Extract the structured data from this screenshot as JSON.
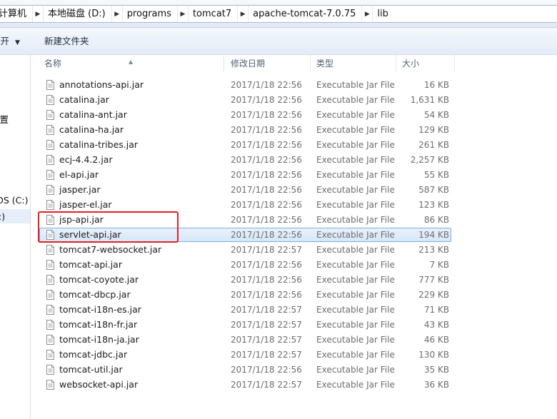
{
  "breadcrumb": {
    "items": [
      "计算机",
      "本地磁盘 (D:)",
      "programs",
      "tomcat7",
      "apache-tomcat-7.0.75",
      "lib"
    ]
  },
  "toolbar": {
    "open_label": "打开",
    "new_folder_label": "新建文件夹"
  },
  "nav": {
    "location_label": "位置",
    "drive_c_label": "OS (C:)",
    "drive_d_label": ":)"
  },
  "columns": {
    "name": "名称",
    "date": "修改日期",
    "type": "类型",
    "size": "大小"
  },
  "files": [
    {
      "name": "annotations-api.jar",
      "date": "2017/1/18 22:56",
      "type": "Executable Jar File",
      "size": "16 KB"
    },
    {
      "name": "catalina.jar",
      "date": "2017/1/18 22:56",
      "type": "Executable Jar File",
      "size": "1,631 KB"
    },
    {
      "name": "catalina-ant.jar",
      "date": "2017/1/18 22:56",
      "type": "Executable Jar File",
      "size": "54 KB"
    },
    {
      "name": "catalina-ha.jar",
      "date": "2017/1/18 22:56",
      "type": "Executable Jar File",
      "size": "129 KB"
    },
    {
      "name": "catalina-tribes.jar",
      "date": "2017/1/18 22:56",
      "type": "Executable Jar File",
      "size": "261 KB"
    },
    {
      "name": "ecj-4.4.2.jar",
      "date": "2017/1/18 22:56",
      "type": "Executable Jar File",
      "size": "2,257 KB"
    },
    {
      "name": "el-api.jar",
      "date": "2017/1/18 22:56",
      "type": "Executable Jar File",
      "size": "55 KB"
    },
    {
      "name": "jasper.jar",
      "date": "2017/1/18 22:56",
      "type": "Executable Jar File",
      "size": "587 KB"
    },
    {
      "name": "jasper-el.jar",
      "date": "2017/1/18 22:56",
      "type": "Executable Jar File",
      "size": "123 KB"
    },
    {
      "name": "jsp-api.jar",
      "date": "2017/1/18 22:56",
      "type": "Executable Jar File",
      "size": "86 KB"
    },
    {
      "name": "servlet-api.jar",
      "date": "2017/1/18 22:56",
      "type": "Executable Jar File",
      "size": "194 KB",
      "selected": true
    },
    {
      "name": "tomcat7-websocket.jar",
      "date": "2017/1/18 22:57",
      "type": "Executable Jar File",
      "size": "213 KB"
    },
    {
      "name": "tomcat-api.jar",
      "date": "2017/1/18 22:56",
      "type": "Executable Jar File",
      "size": "7 KB"
    },
    {
      "name": "tomcat-coyote.jar",
      "date": "2017/1/18 22:56",
      "type": "Executable Jar File",
      "size": "777 KB"
    },
    {
      "name": "tomcat-dbcp.jar",
      "date": "2017/1/18 22:56",
      "type": "Executable Jar File",
      "size": "229 KB"
    },
    {
      "name": "tomcat-i18n-es.jar",
      "date": "2017/1/18 22:57",
      "type": "Executable Jar File",
      "size": "71 KB"
    },
    {
      "name": "tomcat-i18n-fr.jar",
      "date": "2017/1/18 22:57",
      "type": "Executable Jar File",
      "size": "43 KB"
    },
    {
      "name": "tomcat-i18n-ja.jar",
      "date": "2017/1/18 22:57",
      "type": "Executable Jar File",
      "size": "46 KB"
    },
    {
      "name": "tomcat-jdbc.jar",
      "date": "2017/1/18 22:57",
      "type": "Executable Jar File",
      "size": "130 KB"
    },
    {
      "name": "tomcat-util.jar",
      "date": "2017/1/18 22:56",
      "type": "Executable Jar File",
      "size": "35 KB"
    },
    {
      "name": "websocket-api.jar",
      "date": "2017/1/18 22:57",
      "type": "Executable Jar File",
      "size": "36 KB"
    }
  ],
  "colors": {
    "selection_border": "#84acdd",
    "annotation_red": "#e52020"
  }
}
